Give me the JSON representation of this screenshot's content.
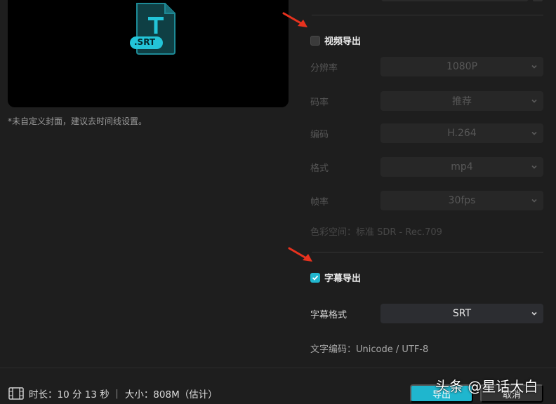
{
  "preview": {
    "file_badge": ".SRT",
    "file_letter": "T",
    "cover_note": "*未自定义封面，建议去时间线设置。"
  },
  "video_export": {
    "title": "视频导出",
    "checked": false,
    "rows": [
      {
        "label": "分辨率",
        "value": "1080P"
      },
      {
        "label": "码率",
        "value": "推荐"
      },
      {
        "label": "编码",
        "value": "H.264"
      },
      {
        "label": "格式",
        "value": "mp4"
      },
      {
        "label": "帧率",
        "value": "30fps"
      }
    ],
    "color_space": "色彩空间：标准 SDR - Rec.709"
  },
  "subtitle_export": {
    "title": "字幕导出",
    "checked": true,
    "format_label": "字幕格式",
    "format_value": "SRT",
    "encoding_text": "文字编码：Unicode / UTF-8"
  },
  "footer": {
    "duration_text": "时长：10 分 13 秒 ｜ 大小：808M（估计）",
    "export_label": "导出",
    "cancel_label": "取消",
    "watermark": "头条 @星话大白"
  },
  "colors": {
    "accent": "#1fb6ce",
    "arrow": "#e8321e",
    "background": "#1e1e1e"
  },
  "icons": [
    "srt-file-icon",
    "chevron-down-icon",
    "checkmark-icon",
    "film-icon",
    "arrow-annotation-icon"
  ]
}
